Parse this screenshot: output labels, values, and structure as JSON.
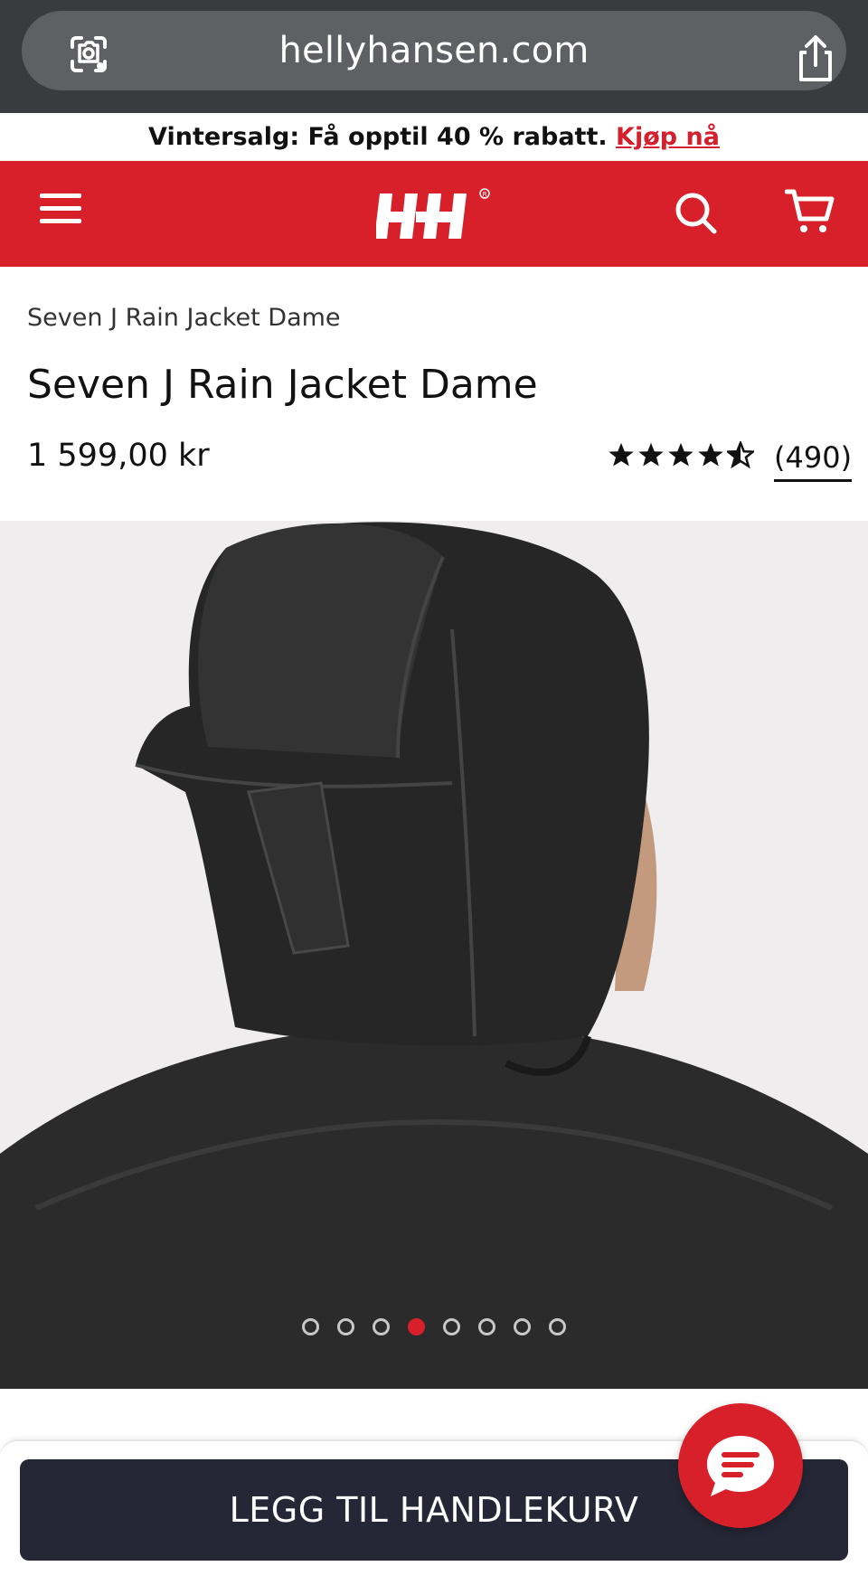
{
  "browser": {
    "url": "hellyhansen.com",
    "icons": [
      "lens-icon",
      "share-icon"
    ]
  },
  "promo": {
    "text": "Vintersalg: Få opptil 40 % rabatt.",
    "link_label": "Kjøp nå",
    "link_color": "#d51f2c"
  },
  "header": {
    "logo_text": "HH",
    "brand_color": "#d8202a",
    "icons": [
      "menu-icon",
      "search-icon",
      "cart-icon"
    ]
  },
  "product": {
    "breadcrumb": "Seven J Rain Jacket Dame",
    "title": "Seven J Rain Jacket Dame",
    "price": "1 599,00 kr",
    "rating": 4.5,
    "rating_max": 5,
    "review_count": "(490)"
  },
  "gallery": {
    "image_count": 8,
    "active_index": 3
  },
  "cta": {
    "label": "LEGG TIL HANDLEKURV",
    "color": "#262736"
  },
  "chat": {
    "icon": "chat-bubble-icon"
  }
}
